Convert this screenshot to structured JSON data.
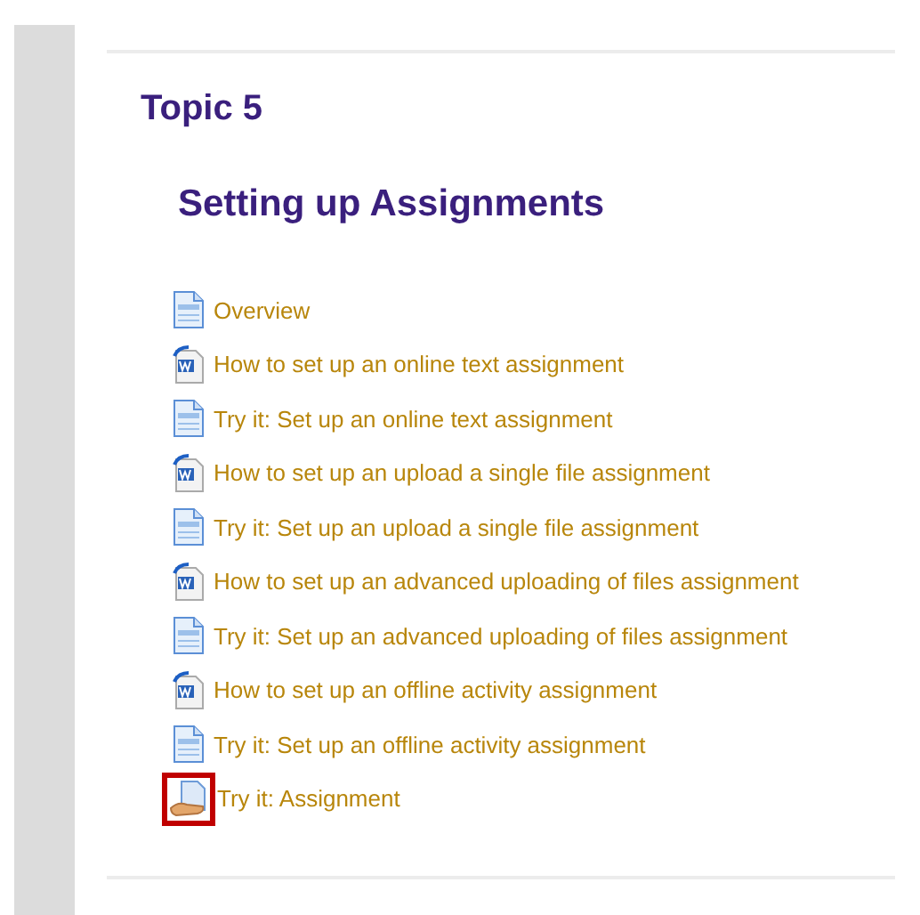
{
  "topic": {
    "title": "Topic 5",
    "heading": "Setting up Assignments"
  },
  "items": [
    {
      "kind": "page",
      "label": "Overview",
      "highlighted": false
    },
    {
      "kind": "document",
      "label": "How to set up an online text assignment",
      "highlighted": false
    },
    {
      "kind": "page",
      "label": "Try it: Set up an online text assignment",
      "highlighted": false
    },
    {
      "kind": "document",
      "label": "How to set up an upload a single file assignment",
      "highlighted": false
    },
    {
      "kind": "page",
      "label": "Try it: Set up an upload a single file assignment",
      "highlighted": false
    },
    {
      "kind": "document",
      "label": "How to set up an advanced uploading of files assignment",
      "highlighted": false
    },
    {
      "kind": "page",
      "label": "Try it: Set up an advanced uploading of files assignment",
      "highlighted": false
    },
    {
      "kind": "document",
      "label": "How to set up an offline activity assignment",
      "highlighted": false
    },
    {
      "kind": "page",
      "label": "Try it: Set up an offline activity assignment",
      "highlighted": false
    },
    {
      "kind": "assignment",
      "label": "Try it: Assignment",
      "highlighted": true
    }
  ]
}
